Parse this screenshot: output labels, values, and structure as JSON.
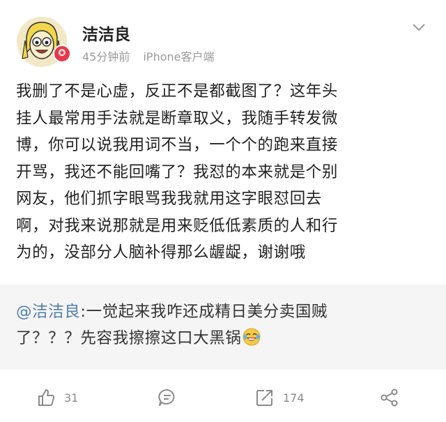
{
  "header": {
    "username": "洁洁良",
    "time": "45分钟前",
    "source": "iPhone客户端"
  },
  "post": {
    "lines": [
      "我删了不是心虚，反正不是都截图了？这年头",
      "挂人最常用手法就是断章取义，我随手转发微",
      "博，你可以说我用词不当，一个个的跑来直接",
      "开骂，我还不能回嘴了？我怼的本来就是个别",
      "网友，他们抓字眼骂我我就用这字眼怼回去",
      "啊，对我来说那就是用来贬低低素质的人和行",
      "为的，没部分人脑补得那么龌龊，谢谢哦"
    ]
  },
  "repost": {
    "mention": "@洁洁良",
    "line1_rest": ":一觉起来我咋还成精日美分卖国贼",
    "line2": "了？？？先容我擦擦这口大黑锅"
  },
  "actions": {
    "like_count": "31",
    "repost_count": "174"
  },
  "icons": {
    "like": "thumbs-up-icon",
    "comment": "comment-icon",
    "repost": "repost-icon",
    "share": "share-icon",
    "dropdown": "chevron-down-icon",
    "emoji": "laughing-crying-emoji"
  },
  "colors": {
    "mention": "#507daf",
    "badge": "#e8374a",
    "meta": "#9a9a9a",
    "repost_bg": "#f5f5f5"
  }
}
